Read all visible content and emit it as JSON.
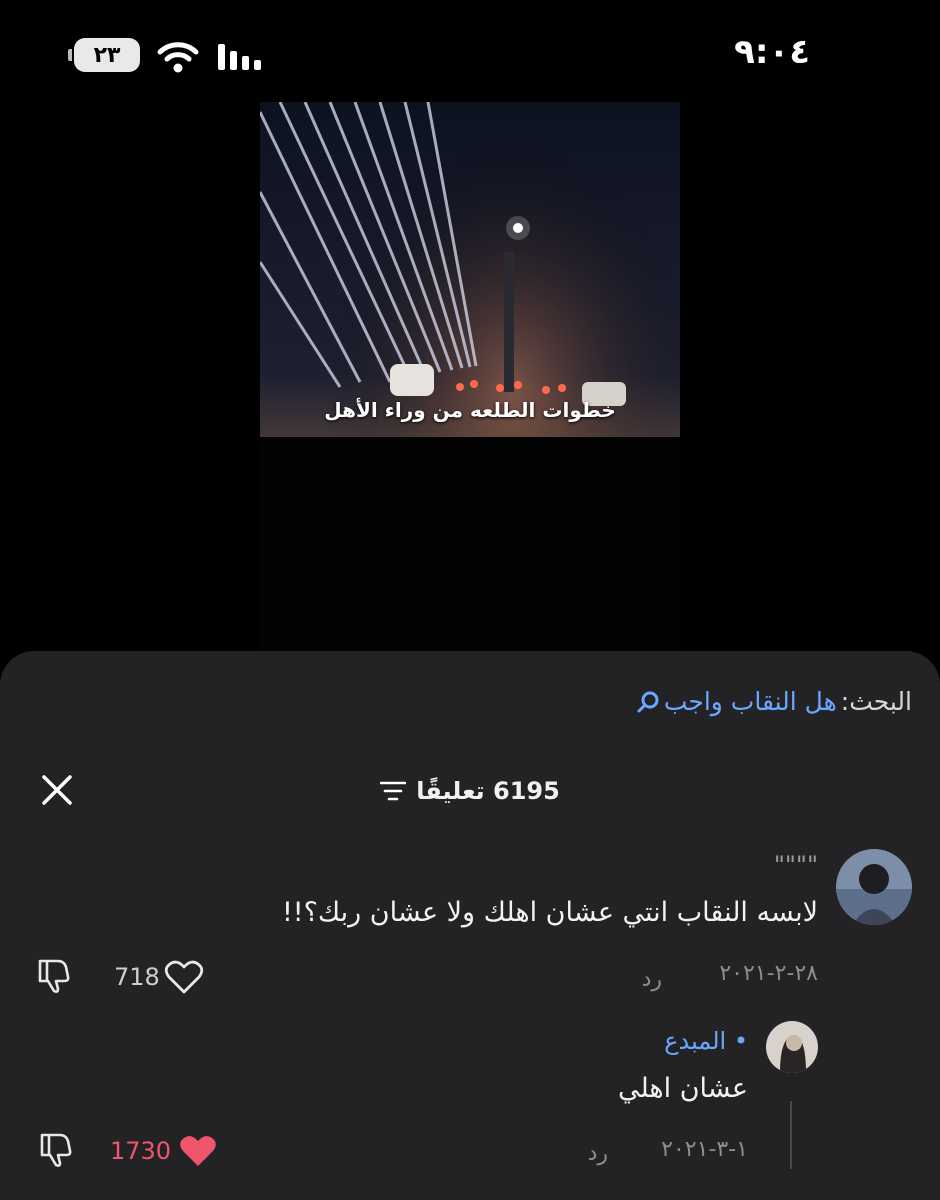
{
  "status_bar": {
    "time": "٩:٠٤",
    "battery": "٢٣"
  },
  "video": {
    "caption": "خطوات الطلعه من وراء الأهل"
  },
  "search": {
    "label": "البحث:",
    "query": "هل النقاب واجب"
  },
  "comments_header": {
    "count_label": "6195 تعليقًا"
  },
  "comments": [
    {
      "username": "\"\"\"\"",
      "text": "لابسه النقاب انتي عشان اهلك ولا عشان ربك؟!!",
      "date": "٢٨-٢-٢٠٢١",
      "reply_label": "رد",
      "likes": "718",
      "liked": false
    }
  ],
  "replies": [
    {
      "username": "• المبدع",
      "text": "عشان اهلي",
      "date": "١-٣-٢٠٢١",
      "reply_label": "رد",
      "likes": "1730",
      "liked": true
    }
  ],
  "colors": {
    "accent_link": "#6aa7ff",
    "like_red": "#f0566b",
    "sheet_bg": "#232326"
  }
}
